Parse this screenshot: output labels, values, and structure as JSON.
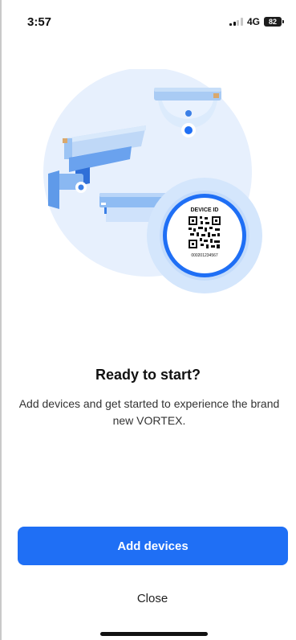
{
  "status_bar": {
    "time": "3:57",
    "network": "4G",
    "battery": "82",
    "signal_bars_active": 2,
    "signal_bars_total": 4
  },
  "illustration": {
    "badge_label": "DEVICE ID",
    "badge_code": "000201234567",
    "icons": [
      "camera-bullet-icon",
      "camera-dome-icon",
      "nvr-icon",
      "qr-code-icon"
    ]
  },
  "content": {
    "title": "Ready to start?",
    "subtitle": "Add devices and get started to experience the brand new VORTEX."
  },
  "actions": {
    "primary_label": "Add devices",
    "secondary_label": "Close"
  },
  "colors": {
    "accent": "#1f6ff5",
    "illustration_light": "#e7f0fd",
    "illustration_mid": "#9cc4f4",
    "illustration_dark": "#3b7fe6"
  }
}
